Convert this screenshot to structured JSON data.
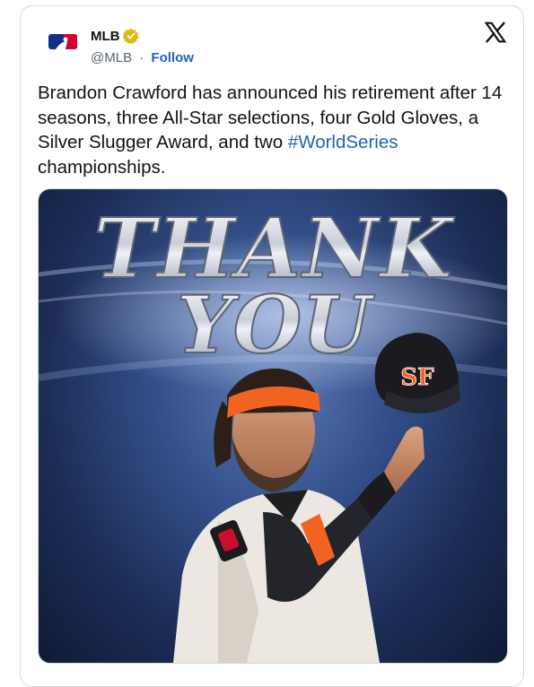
{
  "author": {
    "name": "MLB",
    "handle": "@MLB",
    "separator": "·",
    "follow_label": "Follow",
    "verified": true
  },
  "tweet": {
    "text_part1": "Brandon Crawford has announced his retirement after 14 seasons, three All-Star selections, four Gold Gloves, a Silver Slugger Award, and two ",
    "hashtag": "#WorldSeries",
    "text_part2": " championships."
  },
  "media": {
    "headline_line1": "THANK",
    "headline_line2": "YOU"
  },
  "icons": {
    "verified": "verified-badge-icon",
    "platform": "x-logo-icon",
    "avatar": "mlb-logo-icon"
  },
  "colors": {
    "link": "#1d64b6",
    "text": "#0f1419",
    "muted": "#536471",
    "verified_gold": "#e2b719",
    "giants_orange": "#f26322"
  }
}
